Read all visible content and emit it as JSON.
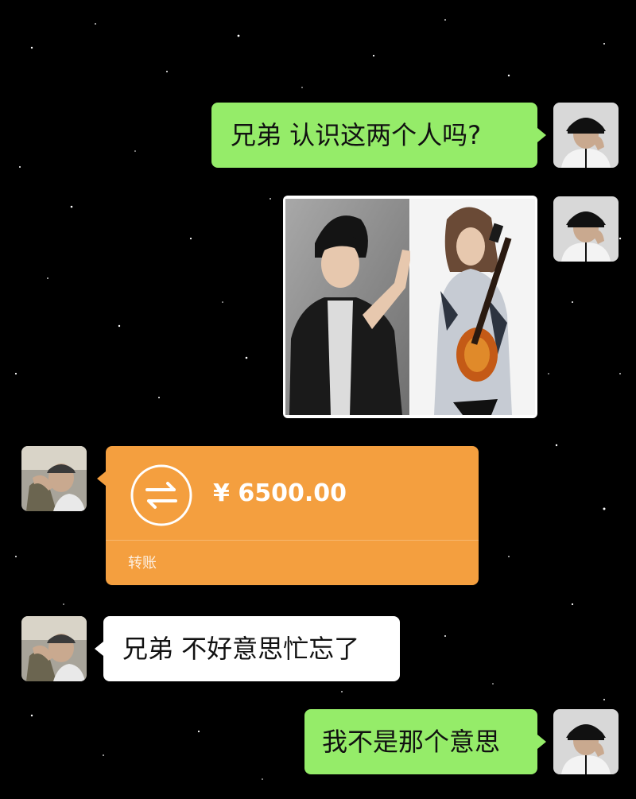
{
  "messages": [
    {
      "side": "right",
      "type": "text",
      "text": "兄弟 认识这两个人吗?"
    },
    {
      "side": "right",
      "type": "image",
      "icon": "photo-two-men-icon"
    },
    {
      "side": "left",
      "type": "transfer",
      "amount": "¥ 6500.00",
      "label": "转账",
      "icon": "transfer-arrows-icon"
    },
    {
      "side": "left",
      "type": "text",
      "text": "兄弟 不好意思忙忘了"
    },
    {
      "side": "right",
      "type": "text",
      "text": "我不是那个意思"
    }
  ],
  "colors": {
    "background": "#000000",
    "sent_bubble": "#95ec69",
    "received_bubble": "#ffffff",
    "transfer_bubble": "#f49f3f"
  }
}
